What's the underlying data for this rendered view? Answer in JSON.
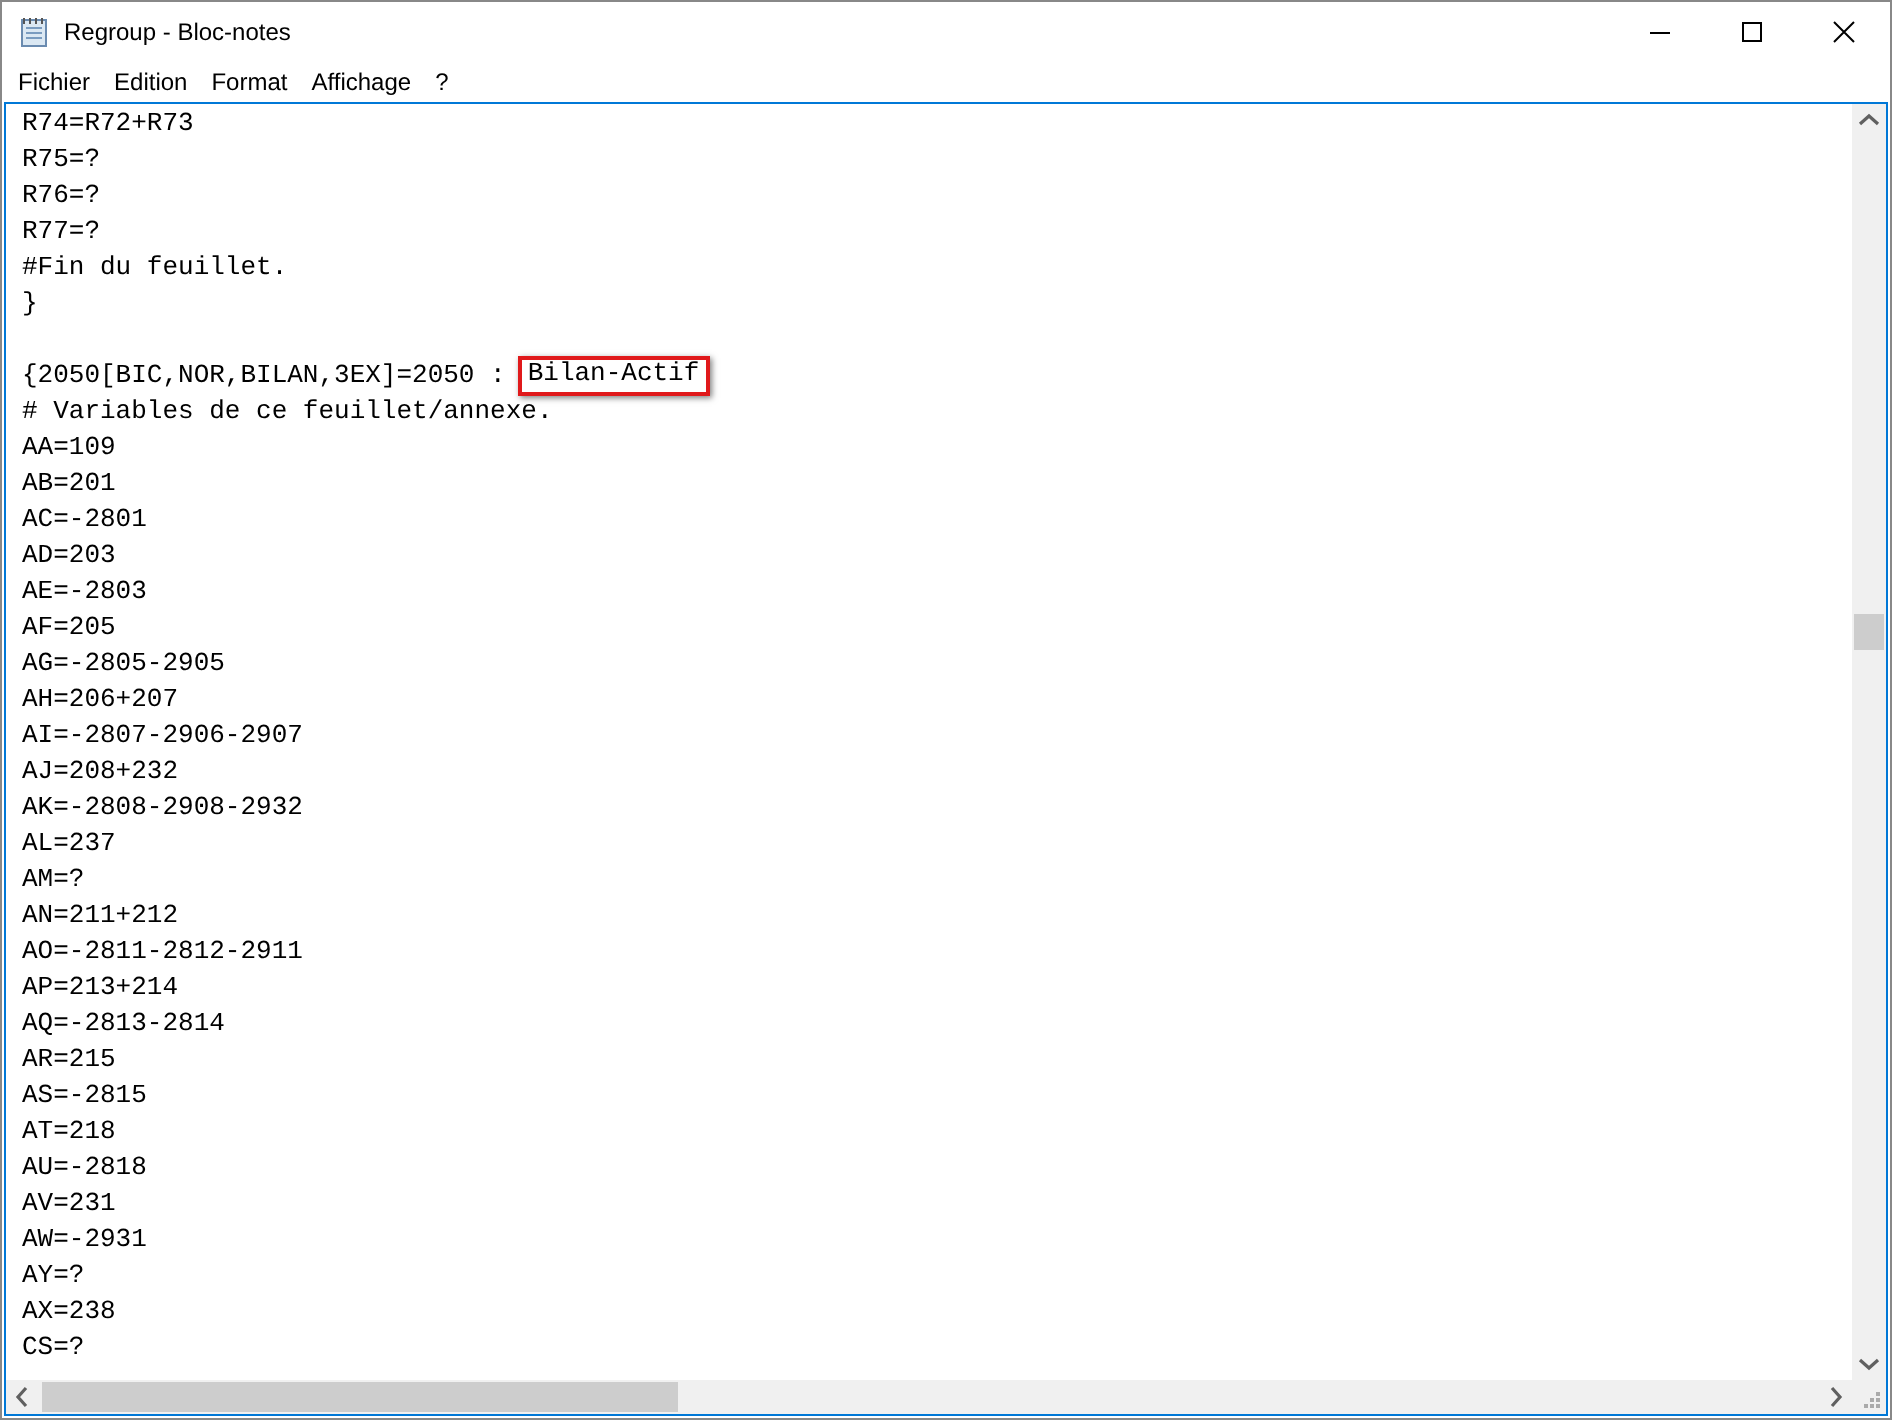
{
  "window": {
    "title": "Regroup - Bloc-notes"
  },
  "menu": [
    "Fichier",
    "Edition",
    "Format",
    "Affichage",
    "?"
  ],
  "lines": [
    {
      "kind": "text",
      "text": "R74=R72+R73"
    },
    {
      "kind": "text",
      "text": "R75=?"
    },
    {
      "kind": "text",
      "text": "R76=?"
    },
    {
      "kind": "text",
      "text": "R77=?"
    },
    {
      "kind": "text",
      "text": "#Fin du feuillet."
    },
    {
      "kind": "text",
      "text": "}"
    },
    {
      "kind": "blank"
    },
    {
      "kind": "marked",
      "text": "{2050[BIC,NOR,BILAN,3EX]=2050 :",
      "marked": "Bilan-Actif"
    },
    {
      "kind": "text",
      "text": "# Variables de ce feuillet/annexe."
    },
    {
      "kind": "text",
      "text": "AA=109"
    },
    {
      "kind": "text",
      "text": "AB=201"
    },
    {
      "kind": "text",
      "text": "AC=-2801"
    },
    {
      "kind": "text",
      "text": "AD=203"
    },
    {
      "kind": "text",
      "text": "AE=-2803"
    },
    {
      "kind": "text",
      "text": "AF=205"
    },
    {
      "kind": "text",
      "text": "AG=-2805-2905"
    },
    {
      "kind": "text",
      "text": "AH=206+207"
    },
    {
      "kind": "text",
      "text": "AI=-2807-2906-2907"
    },
    {
      "kind": "text",
      "text": "AJ=208+232"
    },
    {
      "kind": "text",
      "text": "AK=-2808-2908-2932"
    },
    {
      "kind": "text",
      "text": "AL=237"
    },
    {
      "kind": "text",
      "text": "AM=?"
    },
    {
      "kind": "text",
      "text": "AN=211+212"
    },
    {
      "kind": "text",
      "text": "AO=-2811-2812-2911"
    },
    {
      "kind": "text",
      "text": "AP=213+214"
    },
    {
      "kind": "text",
      "text": "AQ=-2813-2814"
    },
    {
      "kind": "text",
      "text": "AR=215"
    },
    {
      "kind": "text",
      "text": "AS=-2815"
    },
    {
      "kind": "text",
      "text": "AT=218"
    },
    {
      "kind": "text",
      "text": "AU=-2818"
    },
    {
      "kind": "text",
      "text": "AV=231"
    },
    {
      "kind": "text",
      "text": "AW=-2931"
    },
    {
      "kind": "text",
      "text": "AY=?"
    },
    {
      "kind": "text",
      "text": "AX=238"
    },
    {
      "kind": "text",
      "text": "CS=?"
    }
  ]
}
